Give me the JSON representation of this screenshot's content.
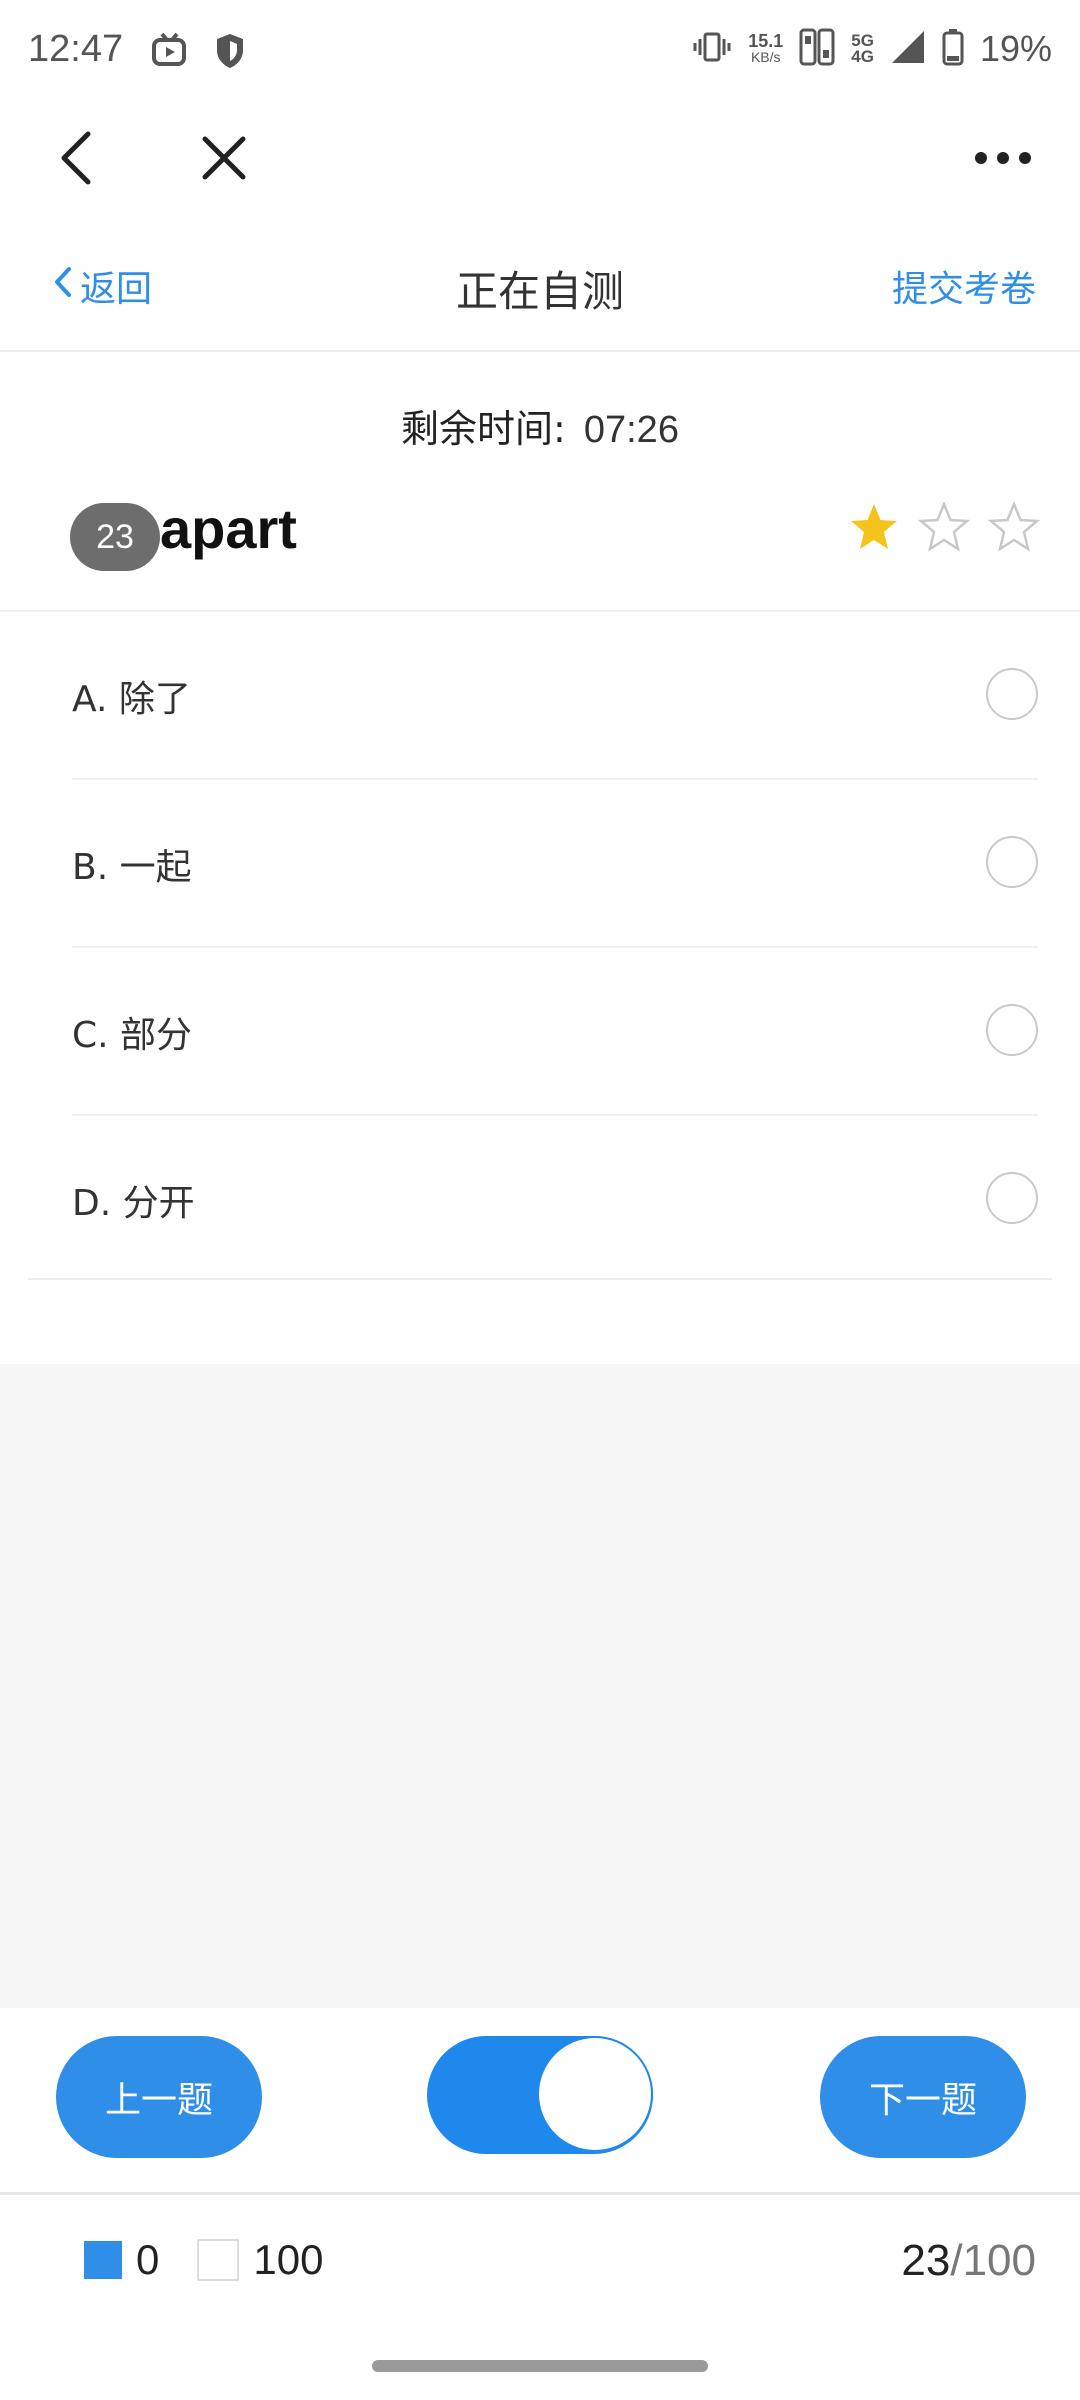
{
  "status_bar": {
    "time": "12:47",
    "net_speed_value": "15.1",
    "net_speed_unit": "KB/s",
    "signal_top": "5G",
    "signal_bottom": "4G",
    "battery": "19%",
    "icons": [
      "tv-icon",
      "shield-icon",
      "vibrate-icon",
      "sim-icon",
      "signal-icon",
      "battery-icon"
    ]
  },
  "browser_nav": {
    "icons": [
      "back-arrow-icon",
      "close-icon",
      "more-icon"
    ]
  },
  "header": {
    "back_label": "返回",
    "title": "正在自测",
    "submit_label": "提交考卷"
  },
  "timer": {
    "label": "剩余时间:",
    "value": "07:26"
  },
  "question": {
    "number": "23",
    "word": "apart",
    "rating": 1,
    "rating_max": 3
  },
  "options": [
    {
      "label": "A. 除了"
    },
    {
      "label": "B. 一起"
    },
    {
      "label": "C. 部分"
    },
    {
      "label": "D. 分开"
    }
  ],
  "controls": {
    "prev_label": "上一题",
    "next_label": "下一题",
    "toggle_on": true
  },
  "footer": {
    "answered_count": "0",
    "unanswered_count": "100",
    "current": "23",
    "separator": "/",
    "total": "100"
  },
  "colors": {
    "accent": "#2f8ee8",
    "toggle": "#1e88ed",
    "star": "#f6c21c",
    "badge": "#6d6d6d"
  }
}
